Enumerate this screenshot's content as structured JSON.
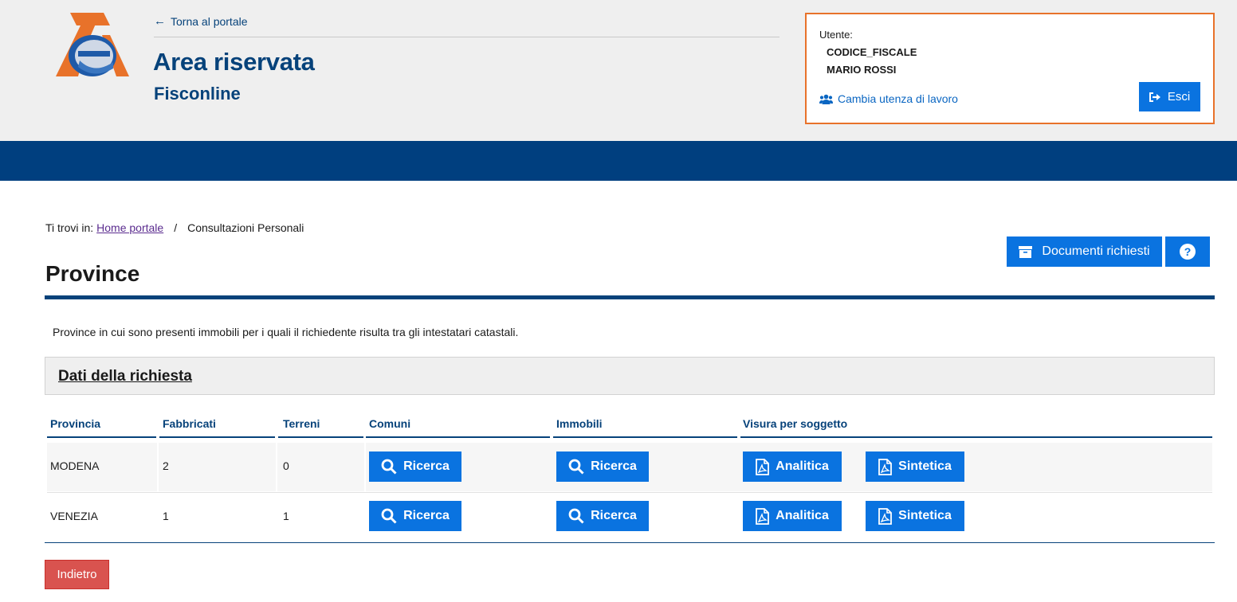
{
  "header": {
    "back_link": "Torna al portale",
    "title": "Area riservata",
    "subtitle": "Fisconline"
  },
  "user": {
    "label": "Utente:",
    "codice_fiscale": "CODICE_FISCALE",
    "name": "MARIO ROSSI",
    "change_user": "Cambia utenza di lavoro",
    "exit_label": "Esci"
  },
  "breadcrumb": {
    "prefix": "Ti trovi in:",
    "home": "Home portale",
    "separator": "/",
    "current": "Consultazioni Personali"
  },
  "toolbar": {
    "documents_label": "Documenti richiesti"
  },
  "page": {
    "title": "Province",
    "description": "Province in cui sono presenti immobili per i quali il richiedente risulta tra gli intestatari catastali.",
    "panel_title": "Dati della richiesta"
  },
  "table": {
    "headers": [
      "Provincia",
      "Fabbricati",
      "Terreni",
      "Comuni",
      "Immobili",
      "Visura per soggetto"
    ],
    "rows": [
      {
        "provincia": "MODENA",
        "fabbricati": "2",
        "terreni": "0",
        "comuni_btn": "Ricerca",
        "immobili_btn": "Ricerca",
        "analitica_btn": "Analitica",
        "sintetica_btn": "Sintetica"
      },
      {
        "provincia": "VENEZIA",
        "fabbricati": "1",
        "terreni": "1",
        "comuni_btn": "Ricerca",
        "immobili_btn": "Ricerca",
        "analitica_btn": "Analitica",
        "sintetica_btn": "Sintetica"
      }
    ]
  },
  "footer": {
    "back_label": "Indietro"
  },
  "colors": {
    "primary_blue": "#0a73e0",
    "dark_blue": "#003f7f",
    "accent_orange": "#e8722a",
    "danger_red": "#d9534f"
  },
  "icons": {
    "logo": "agenzia-entrate-logo",
    "back": "arrow-left-icon",
    "users": "users-icon",
    "exit": "sign-out-icon",
    "archive": "archive-icon",
    "help": "question-circle-icon",
    "search": "search-icon",
    "pdf": "file-pdf-icon"
  }
}
